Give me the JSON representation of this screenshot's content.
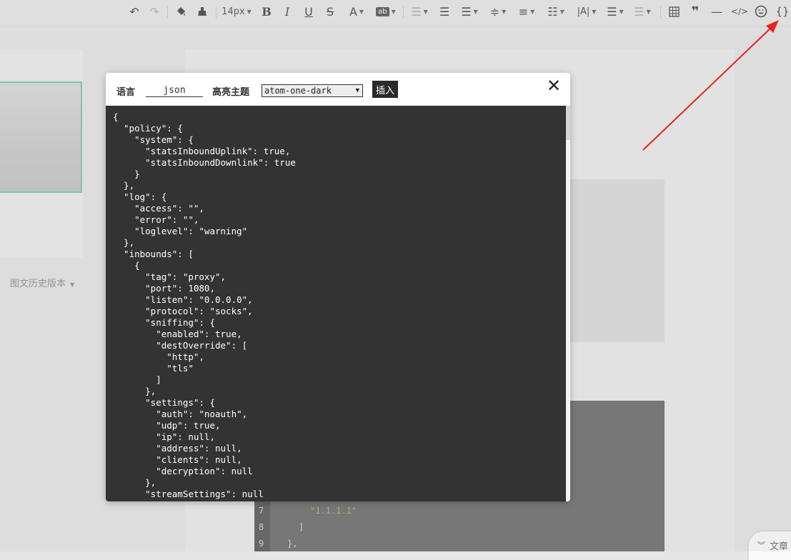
{
  "toolbar": {
    "font_size": "14px",
    "icons": [
      "undo-icon",
      "redo-icon",
      "format-brush-icon",
      "clear-format-icon",
      "bold-icon",
      "italic-icon",
      "underline-icon",
      "strikethrough-icon",
      "font-color-icon",
      "highlight-icon",
      "align-left-icon",
      "indent-icon",
      "align-center-icon",
      "line-height-icon",
      "paragraph-spacing-icon",
      "list-indent-icon",
      "letter-spacing-icon",
      "bullet-list-icon",
      "justify-icon",
      "table-icon",
      "quote-icon",
      "divider-icon",
      "code-icon",
      "emoji-icon",
      "code-block-icon"
    ],
    "highlight_label": "ab",
    "code_block_glyph": "{}"
  },
  "sidebar": {
    "history_label": "图文历史版本"
  },
  "article_tab": {
    "label": "文章"
  },
  "modal": {
    "language_label": "语言",
    "language_value": "json",
    "theme_label": "高亮主题",
    "theme_value": "atom-one-dark",
    "insert_label": "插入",
    "close_glyph": "✕",
    "code": "{\n  \"policy\": {\n    \"system\": {\n      \"statsInboundUplink\": true,\n      \"statsInboundDownlink\": true\n    }\n  },\n  \"log\": {\n    \"access\": \"\",\n    \"error\": \"\",\n    \"loglevel\": \"warning\"\n  },\n  \"inbounds\": [\n    {\n      \"tag\": \"proxy\",\n      \"port\": 1080,\n      \"listen\": \"0.0.0.0\",\n      \"protocol\": \"socks\",\n      \"sniffing\": {\n        \"enabled\": true,\n        \"destOverride\": [\n          \"http\",\n          \"tls\"\n        ]\n      },\n      \"settings\": {\n        \"auth\": \"noauth\",\n        \"udp\": true,\n        \"ip\": null,\n        \"address\": null,\n        \"clients\": null,\n        \"decryption\": null\n      },\n      \"streamSettings\": null"
  },
  "background_code": {
    "lines": [
      {
        "num": "7",
        "text": "\"1.1.1.1\""
      },
      {
        "num": "8",
        "text": "]"
      },
      {
        "num": "9",
        "text": "},"
      }
    ],
    "string_color": "#98c379"
  },
  "colors": {
    "code_bg": "#333333",
    "arrow": "#e8231e",
    "selection_border": "#7fd3a7"
  }
}
